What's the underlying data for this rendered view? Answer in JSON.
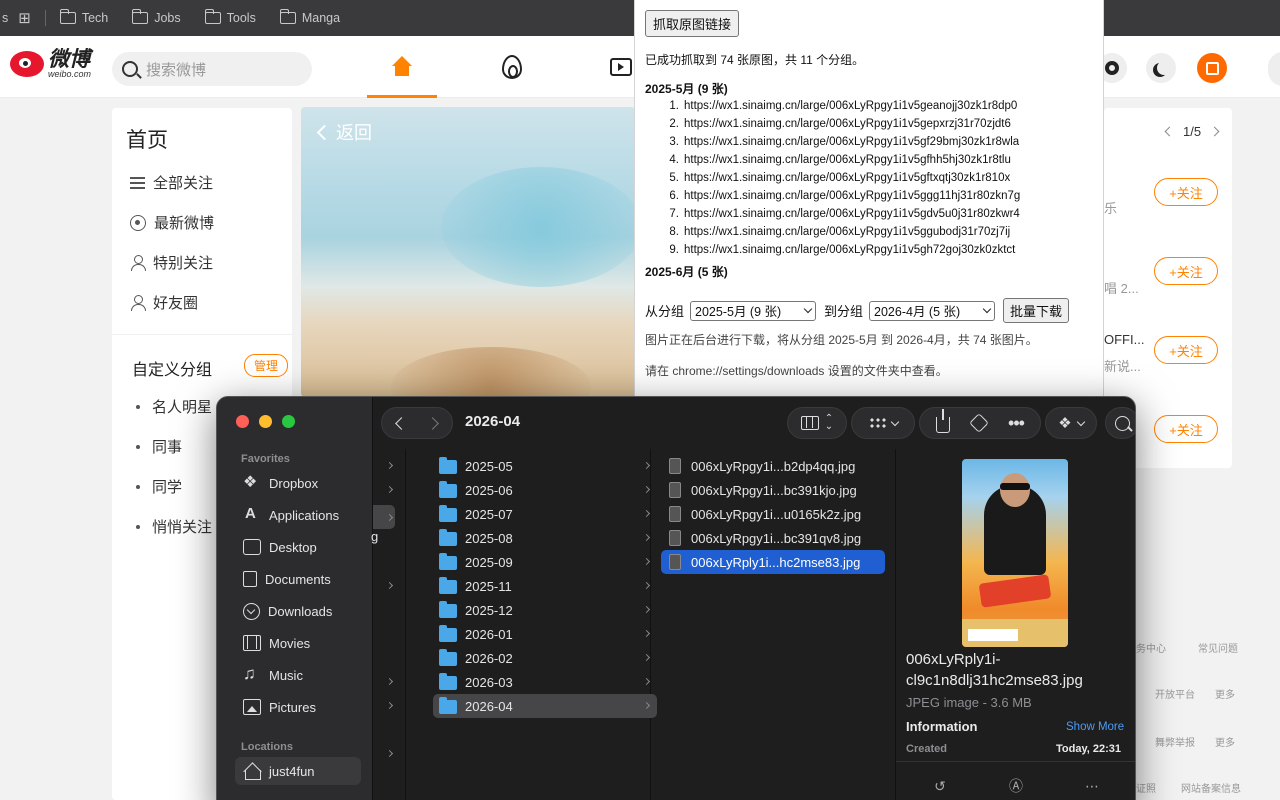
{
  "bookmarks": {
    "leading_char": "s",
    "items": [
      "Tech",
      "Jobs",
      "Tools",
      "Manga"
    ]
  },
  "weibo": {
    "logo_cn": "微博",
    "logo_en": "weibo.com",
    "search_placeholder": "搜索微博",
    "sidebar": {
      "title": "首页",
      "items": [
        "全部关注",
        "最新微博",
        "特别关注",
        "好友圈"
      ],
      "group_title": "自定义分组",
      "manage_label": "管理",
      "groups": [
        "名人明星",
        "同事",
        "同学",
        "悄悄关注"
      ]
    },
    "hero": {
      "back_label": "返回"
    },
    "right": {
      "pager": "1/5",
      "follow_label": "+关注",
      "fragments": [
        "乐",
        "唱 2...",
        "OFFI...",
        "新说..."
      ],
      "footer": [
        "务中心",
        "常见问题",
        "开放平台",
        "更多",
        "舞弊举报",
        "更多",
        "证照",
        "网站备案信息"
      ]
    },
    "colors": {
      "accent": "#ff8200",
      "logo_red": "#e6162d"
    }
  },
  "popup": {
    "grab_button": "抓取原图链接",
    "summary": "已成功抓取到 74 张原图，共 11 个分组。",
    "group1_title": "2025-5月 (9 张)",
    "urls": [
      "https://wx1.sinaimg.cn/large/006xLyRpgy1i1v5geanojj30zk1r8dp0",
      "https://wx1.sinaimg.cn/large/006xLyRpgy1i1v5gepxrzj31r70zjdt6",
      "https://wx1.sinaimg.cn/large/006xLyRpgy1i1v5gf29bmj30zk1r8wla",
      "https://wx1.sinaimg.cn/large/006xLyRpgy1i1v5gfhh5hj30zk1r8tlu",
      "https://wx1.sinaimg.cn/large/006xLyRpgy1i1v5gftxqtj30zk1r810x",
      "https://wx1.sinaimg.cn/large/006xLyRpgy1i1v5ggg11hj31r80zkn7g",
      "https://wx1.sinaimg.cn/large/006xLyRpgy1i1v5gdv5u0j31r80zkwr4",
      "https://wx1.sinaimg.cn/large/006xLyRpgy1i1v5ggubodj31r70zj7ij",
      "https://wx1.sinaimg.cn/large/006xLyRpgy1i1v5gh72goj30zk0zktct"
    ],
    "group2_title": "2025-6月 (5 张)",
    "from_label": "从分组",
    "from_value": "2025-5月 (9 张)",
    "to_label": "到分组",
    "to_value": "2026-4月 (5 张)",
    "download_button": "批量下载",
    "status_note": "图片正在后台进行下载，将从分组 2025-5月 到 2026-4月，共 74 张图片。",
    "settings_note": "请在 chrome://settings/downloads 设置的文件夹中查看。"
  },
  "finder": {
    "title": "2026-04",
    "favorites_label": "Favorites",
    "favorites": [
      {
        "label": "Dropbox",
        "icon": "dropbox-icon"
      },
      {
        "label": "Applications",
        "icon": "applications-icon"
      },
      {
        "label": "Desktop",
        "icon": "desktop-icon"
      },
      {
        "label": "Documents",
        "icon": "document-icon"
      },
      {
        "label": "Downloads",
        "icon": "download-icon"
      },
      {
        "label": "Movies",
        "icon": "film-icon"
      },
      {
        "label": "Music",
        "icon": "music-icon"
      },
      {
        "label": "Pictures",
        "icon": "pictures-icon"
      }
    ],
    "locations_label": "Locations",
    "location_item": "just4fun",
    "col1_letter": "g",
    "folders": [
      "2025-05",
      "2025-06",
      "2025-07",
      "2025-08",
      "2025-09",
      "2025-11",
      "2025-12",
      "2026-01",
      "2026-02",
      "2026-03",
      "2026-04"
    ],
    "selected_folder": "2026-04",
    "files": [
      "006xLyRpgy1i...b2dp4qq.jpg",
      "006xLyRpgy1i...bc391kjo.jpg",
      "006xLyRpgy1i...u0165k2z.jpg",
      "006xLyRpgy1i...bc391qv8.jpg",
      "006xLyRply1i...hc2mse83.jpg"
    ],
    "selected_file": "006xLyRply1i...hc2mse83.jpg",
    "preview": {
      "name_line1": "006xLyRply1i-",
      "name_line2": "cl9c1n8dlj31hc2mse83.jpg",
      "type": "JPEG image - 3.6 MB",
      "info_label": "Information",
      "show_more": "Show More",
      "created_label": "Created",
      "created_value": "Today, 22:31"
    },
    "colors": {
      "selection": "#1f5fd1",
      "folder": "#4aa7e8"
    }
  }
}
